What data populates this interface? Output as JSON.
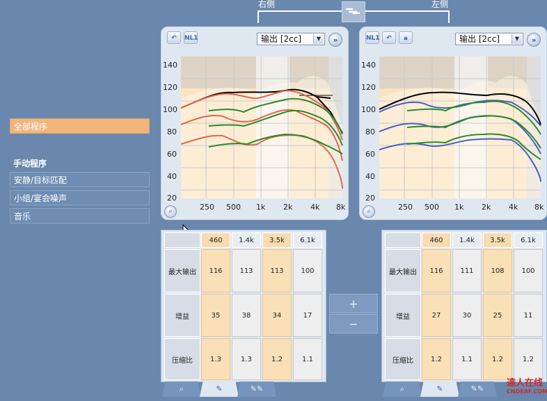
{
  "header": {
    "right_side_label": "右侧",
    "left_side_label": "左侧",
    "link_icon": "link-icon"
  },
  "sidebar": {
    "all_programs": "全部程序",
    "manual_programs_header": "手动程序",
    "programs": [
      "安静/目标匹配",
      "小组/宴会噪声",
      "音乐"
    ]
  },
  "panels": {
    "right": {
      "nl_button": "NL1",
      "select_value": "输出 [2cc]",
      "yticks": [
        "140",
        "120",
        "100",
        "80",
        "60",
        "40",
        "20"
      ],
      "xticks": [
        "250",
        "500",
        "1k",
        "2k",
        "4k",
        "8k"
      ]
    },
    "left": {
      "nl_button": "NL1",
      "select_value": "输出 [2cc]",
      "yticks": [
        "140",
        "120",
        "100",
        "80",
        "60",
        "40",
        "20"
      ],
      "xticks": [
        "250",
        "500",
        "1k",
        "2k",
        "4k",
        "8k"
      ]
    }
  },
  "tables": {
    "right": {
      "headers": [
        "460",
        "1.4k",
        "3.5k",
        "6.1k"
      ],
      "row_labels": [
        "最大输出",
        "增益",
        "压缩比"
      ],
      "rows": [
        [
          "116",
          "113",
          "113",
          "100"
        ],
        [
          "35",
          "38",
          "34",
          "17"
        ],
        [
          "1.3",
          "1.3",
          "1.2",
          "1.1"
        ]
      ]
    },
    "left": {
      "headers": [
        "460",
        "1.4k",
        "3.5k",
        "6.1k"
      ],
      "row_labels": [
        "最大输出",
        "增益",
        "压缩比"
      ],
      "rows": [
        [
          "116",
          "111",
          "108",
          "100"
        ],
        [
          "27",
          "30",
          "25",
          "11"
        ],
        [
          "1.2",
          "1.1",
          "1.2",
          "1.2"
        ]
      ]
    }
  },
  "adjust": {
    "plus": "+",
    "minus": "−"
  },
  "watermark": {
    "line1": "達人在线",
    "line2": "CNDEAF.COM"
  },
  "colors": {
    "background": "#6a88ad",
    "accent_orange": "#f1b57e",
    "curve_red": "#e0674a",
    "curve_green": "#2a8a2a",
    "curve_blue": "#4a5fc4",
    "target_black": "#000000"
  }
}
